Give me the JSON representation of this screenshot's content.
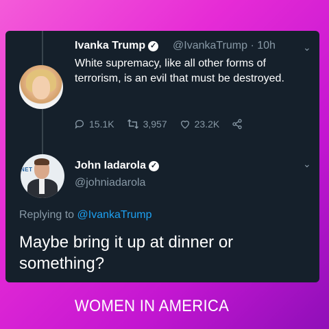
{
  "tweet1": {
    "author_name": "Ivanka Trump",
    "handle": "@IvankaTrump",
    "separator": "·",
    "time": "10h",
    "text": "White supremacy, like all other forms of terrorism, is an evil that must be destroyed.",
    "replies": "15.1K",
    "retweets": "3,957",
    "likes": "23.2K",
    "icons": [
      "reply-icon",
      "retweet-icon",
      "like-icon",
      "share-icon",
      "chevron-down-icon",
      "verified-badge-icon"
    ]
  },
  "tweet2": {
    "author_name": "John Iadarola",
    "handle": "@johniadarola",
    "replying_label": "Replying to",
    "replying_mention": "@IvankaTrump",
    "text": "Maybe bring it up at dinner or something?",
    "avatar_logo_text": "NET"
  },
  "footer": {
    "caption": "WOMEN IN AMERICA"
  },
  "colors": {
    "card_bg": "#15202b",
    "muted_text": "#8899a6",
    "link": "#1da1f2",
    "frame_gradient_start": "#f45bd9",
    "frame_gradient_end": "#8f0fb8"
  }
}
